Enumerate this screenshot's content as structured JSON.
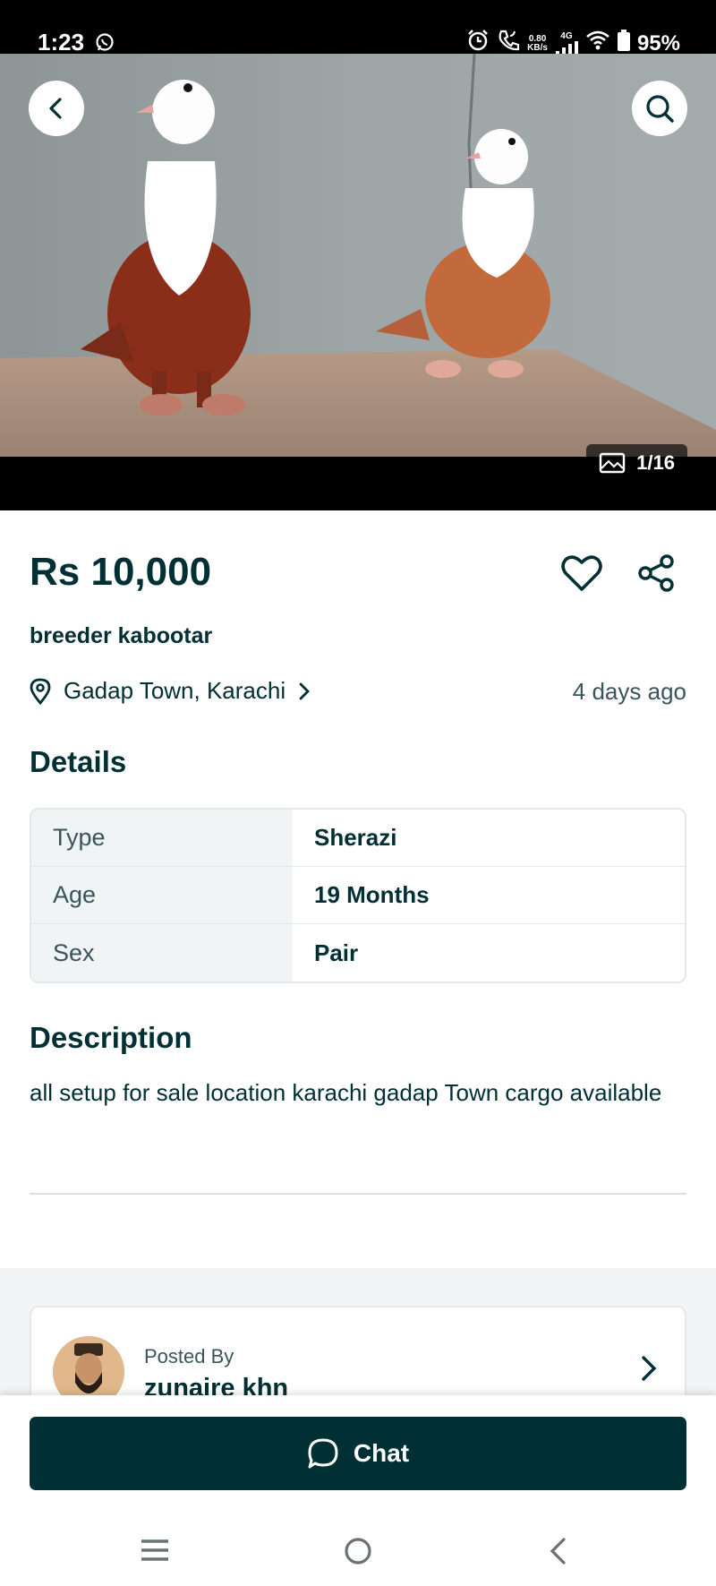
{
  "status_bar": {
    "time": "1:23",
    "speed_value": "0.80",
    "speed_unit": "KB/s",
    "network": "4G",
    "battery": "95%"
  },
  "gallery": {
    "counter": "1/16"
  },
  "listing": {
    "price": "Rs 10,000",
    "title": "breeder kabootar",
    "location": "Gadap Town, Karachi",
    "posted": "4 days ago"
  },
  "details": {
    "heading": "Details",
    "rows": [
      {
        "key": "Type",
        "value": "Sherazi"
      },
      {
        "key": "Age",
        "value": "19 Months"
      },
      {
        "key": "Sex",
        "value": "Pair"
      }
    ]
  },
  "description": {
    "heading": "Description",
    "text": "all setup for sale location karachi gadap Town cargo available"
  },
  "seller": {
    "posted_by_label": "Posted By",
    "name": "zunaire khn"
  },
  "actions": {
    "chat_label": "Chat"
  },
  "colors": {
    "primary": "#002f34",
    "muted_bg": "#f2f4f5"
  }
}
